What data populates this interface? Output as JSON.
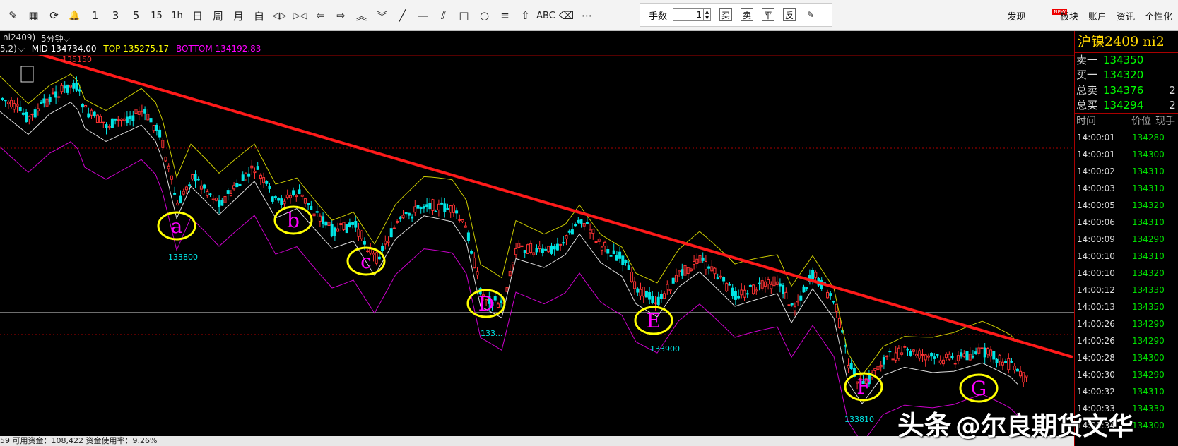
{
  "toolbar": {
    "tools": [
      {
        "name": "draw-tool-icon",
        "glyph": "✎"
      },
      {
        "name": "layout-icon",
        "glyph": "▦"
      },
      {
        "name": "refresh-icon",
        "glyph": "⟳"
      },
      {
        "name": "bell-icon",
        "glyph": "🔔"
      },
      {
        "name": "period-1",
        "glyph": "1"
      },
      {
        "name": "period-3",
        "glyph": "3"
      },
      {
        "name": "period-5",
        "glyph": "5"
      },
      {
        "name": "period-15",
        "glyph": "15"
      },
      {
        "name": "period-1h",
        "glyph": "1h"
      },
      {
        "name": "period-day",
        "glyph": "日"
      },
      {
        "name": "period-week",
        "glyph": "周"
      },
      {
        "name": "period-month",
        "glyph": "月"
      },
      {
        "name": "period-custom",
        "glyph": "自"
      },
      {
        "name": "zoom-in-icon",
        "glyph": "◁▷"
      },
      {
        "name": "zoom-out-icon",
        "glyph": "▷◁"
      },
      {
        "name": "back-icon",
        "glyph": "⇦"
      },
      {
        "name": "forward-icon",
        "glyph": "⇨"
      },
      {
        "name": "up-icon",
        "glyph": "︽"
      },
      {
        "name": "down-icon",
        "glyph": "︾"
      },
      {
        "name": "line-tool-icon",
        "glyph": "╱"
      },
      {
        "name": "hline-tool-icon",
        "glyph": "—"
      },
      {
        "name": "parallel-tool-icon",
        "glyph": "⫽"
      },
      {
        "name": "rect-tool-icon",
        "glyph": "□"
      },
      {
        "name": "ellipse-tool-icon",
        "glyph": "○"
      },
      {
        "name": "fib-tool-icon",
        "glyph": "≡"
      },
      {
        "name": "arrow-tool-icon",
        "glyph": "⇧"
      },
      {
        "name": "text-tool-icon",
        "glyph": "ABC"
      },
      {
        "name": "eraser-icon",
        "glyph": "⌫"
      },
      {
        "name": "more-icon",
        "glyph": "⋯"
      }
    ],
    "order": {
      "qty_label": "手数",
      "qty_value": "1",
      "buttons": [
        "买",
        "卖",
        "平",
        "反"
      ]
    },
    "menu": [
      {
        "label": "发现",
        "badge": "NEW"
      },
      {
        "label": "板块"
      },
      {
        "label": "账户"
      },
      {
        "label": "资讯"
      },
      {
        "label": "个性化"
      }
    ]
  },
  "chart_head": {
    "symbol": "ni2409)",
    "period": "5分钟"
  },
  "indicator": {
    "params": "5,2)",
    "mid_label": "MID",
    "mid_value": "134734.00",
    "top_label": "TOP",
    "top_value": "135275.17",
    "bottom_label": "BOTTOM",
    "bottom_value": "134192.83",
    "colors": {
      "mid": "#ffffff",
      "top": "#ffff00",
      "bottom": "#ff00ff"
    }
  },
  "chart_labels": {
    "high": "135150",
    "low_a": "133800",
    "low_e": "133900",
    "low_f": "133810",
    "low_d": "133..."
  },
  "markers": [
    "a",
    "b",
    "c",
    "D",
    "E",
    "F",
    "G"
  ],
  "panel": {
    "title": "沪镍2409  ni2",
    "sell1_label": "卖一",
    "sell1_value": "134350",
    "buy1_label": "买一",
    "buy1_value": "134320",
    "total_sell_label": "总卖",
    "total_sell_value": "134376",
    "total_sell_extra": "2",
    "total_buy_label": "总买",
    "total_buy_value": "134294",
    "total_buy_extra": "2",
    "col_time": "时间",
    "col_price": "价位",
    "col_vol": "现手",
    "ticks": [
      {
        "time": "14:00:01",
        "price": "134280"
      },
      {
        "time": "14:00:01",
        "price": "134300"
      },
      {
        "time": "14:00:02",
        "price": "134310"
      },
      {
        "time": "14:00:03",
        "price": "134310"
      },
      {
        "time": "14:00:05",
        "price": "134320"
      },
      {
        "time": "14:00:06",
        "price": "134310"
      },
      {
        "time": "14:00:09",
        "price": "134290"
      },
      {
        "time": "14:00:10",
        "price": "134310"
      },
      {
        "time": "14:00:10",
        "price": "134320"
      },
      {
        "time": "14:00:12",
        "price": "134330"
      },
      {
        "time": "14:00:13",
        "price": "134350"
      },
      {
        "time": "14:00:26",
        "price": "134290"
      },
      {
        "time": "14:00:26",
        "price": "134290"
      },
      {
        "time": "14:00:28",
        "price": "134300"
      },
      {
        "time": "14:00:30",
        "price": "134290"
      },
      {
        "time": "14:00:32",
        "price": "134310"
      },
      {
        "time": "14:00:33",
        "price": "134330"
      },
      {
        "time": "14:00:34",
        "price": "134300"
      }
    ]
  },
  "status": {
    "text": "59    可用资金：108,422    资金使用率：9.26%"
  },
  "watermark": {
    "logo": "头条",
    "text": "@尔良期货文华"
  }
}
